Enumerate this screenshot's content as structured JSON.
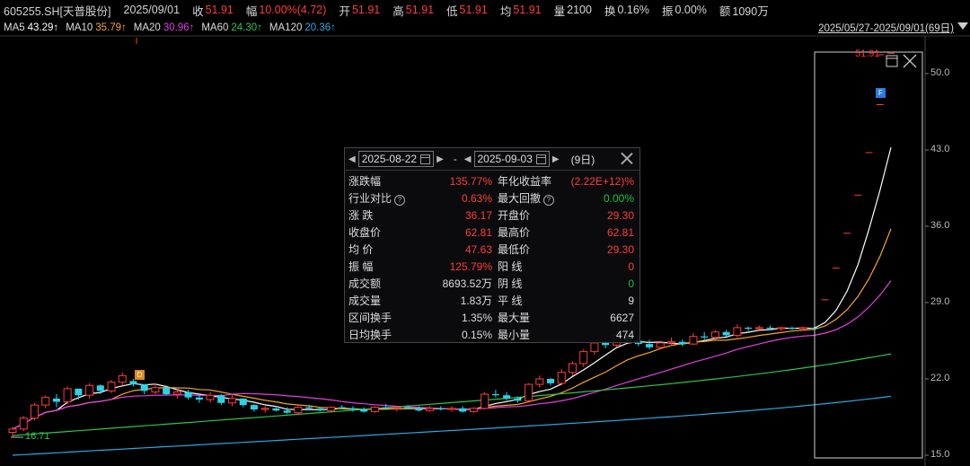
{
  "header": {
    "code": "605255.SH[天普股份]",
    "date": "2025/09/01",
    "close_label": "收",
    "close_value": "51.91",
    "change_label": "幅",
    "change_value": "10.00%(4.72)",
    "open_label": "开",
    "open_value": "51.91",
    "high_label": "高",
    "high_value": "51.91",
    "low_label": "低",
    "low_value": "51.91",
    "avg_label": "均",
    "avg_value": "51.91",
    "volume_label": "量",
    "volume_value": "2100",
    "turnover_label": "换",
    "turnover_value": "0.16%",
    "amplitude_label": "振",
    "amplitude_value": "0.00%",
    "amount_label": "额",
    "amount_value": "1090万"
  },
  "ma_bar": [
    {
      "name": "MA5",
      "value": "43.29↑",
      "color": "#ffffff"
    },
    {
      "name": "MA10",
      "value": "35.79↑",
      "color": "#f5a623"
    },
    {
      "name": "MA20",
      "value": "30.96↑",
      "color": "#e040e0"
    },
    {
      "name": "MA60",
      "value": "24.30↑",
      "color": "#2ec54a"
    },
    {
      "name": "MA120",
      "value": "20.36↑",
      "color": "#2aa8e0"
    }
  ],
  "date_range": "2025/05/27-2025/09/01(69日)",
  "popup": {
    "start_date": "2025-08-22",
    "end_date": "2025-09-03",
    "days": "(9日)",
    "rows": [
      {
        "l1": "涨跌幅",
        "v1": "135.77%",
        "c1": "r",
        "l2": "年化收益率",
        "v2": "(2.22E+12)%",
        "c2": "r"
      },
      {
        "l1": "行业对比",
        "q1": true,
        "v1": "0.63%",
        "c1": "r",
        "l2": "最大回撤",
        "q2": true,
        "v2": "0.00%",
        "c2": "g"
      },
      {
        "l1": "涨 跌",
        "v1": "36.17",
        "c1": "r",
        "l2": "开盘价",
        "v2": "29.30",
        "c2": "r"
      },
      {
        "l1": "收盘价",
        "v1": "62.81",
        "c1": "r",
        "l2": "最高价",
        "v2": "62.81",
        "c2": "r"
      },
      {
        "l1": "均 价",
        "v1": "47.63",
        "c1": "r",
        "l2": "最低价",
        "v2": "29.30",
        "c2": "r"
      },
      {
        "l1": "振 幅",
        "v1": "125.79%",
        "c1": "r",
        "l2": "阳 线",
        "v2": "0",
        "c2": "r"
      },
      {
        "l1": "成交额",
        "v1": "8693.52万",
        "c1": "w",
        "l2": "阴 线",
        "v2": "0",
        "c2": "g"
      },
      {
        "l1": "成交量",
        "v1": "1.83万",
        "c1": "w",
        "l2": "平 线",
        "v2": "9",
        "c2": "w"
      },
      {
        "l1": "区间换手",
        "v1": "1.35%",
        "c1": "w",
        "l2": "最大量",
        "v2": "6627",
        "c2": "w"
      },
      {
        "l1": "日均换手",
        "v1": "0.15%",
        "c1": "w",
        "l2": "最小量",
        "v2": "474",
        "c2": "w"
      }
    ]
  },
  "axis": {
    "labels": [
      "50.0",
      "43.0",
      "36.0",
      "29.0",
      "22.0",
      "15.0"
    ],
    "values": [
      50,
      43,
      36,
      29,
      22,
      15
    ]
  },
  "annotations": {
    "max_price": "51.91",
    "min_price": "16.71",
    "marker_d": "D",
    "marker_f": "F"
  },
  "chart_data": {
    "type": "candlestick",
    "ylim": [
      15,
      52
    ],
    "candles": [
      [
        17.1,
        17.6,
        16.7,
        17.4
      ],
      [
        17.4,
        18.6,
        17.2,
        18.4
      ],
      [
        18.4,
        19.8,
        18.2,
        19.6
      ],
      [
        19.6,
        20.5,
        19.3,
        20.3
      ],
      [
        20.2,
        20.6,
        19.4,
        19.9
      ],
      [
        19.9,
        21.3,
        19.7,
        21.1
      ],
      [
        21.1,
        21.0,
        20.1,
        20.5
      ],
      [
        20.5,
        21.6,
        20.2,
        21.4
      ],
      [
        21.4,
        21.5,
        20.6,
        20.9
      ],
      [
        20.9,
        21.9,
        20.7,
        21.7
      ],
      [
        21.7,
        22.6,
        21.4,
        22.3
      ],
      [
        21.8,
        22.0,
        21.3,
        21.5
      ],
      [
        21.5,
        21.5,
        20.6,
        20.9
      ],
      [
        20.8,
        21.6,
        20.6,
        21.2
      ],
      [
        21.2,
        21.4,
        20.5,
        20.6
      ],
      [
        20.6,
        21.0,
        20.2,
        20.8
      ],
      [
        20.8,
        21.0,
        20.1,
        20.3
      ],
      [
        20.3,
        20.7,
        19.8,
        20.1
      ],
      [
        20.1,
        20.8,
        19.8,
        20.5
      ],
      [
        20.5,
        20.6,
        19.6,
        19.8
      ],
      [
        19.8,
        20.5,
        19.5,
        20.2
      ],
      [
        20.2,
        20.2,
        19.4,
        19.6
      ],
      [
        19.6,
        19.7,
        19.0,
        19.2
      ],
      [
        19.2,
        19.5,
        18.9,
        19.3
      ],
      [
        19.3,
        19.5,
        19.0,
        19.1
      ],
      [
        19.1,
        19.4,
        18.8,
        18.9
      ],
      [
        18.9,
        19.5,
        18.8,
        19.4
      ],
      [
        19.4,
        19.6,
        19.1,
        19.3
      ],
      [
        19.3,
        19.4,
        19.0,
        19.1
      ],
      [
        19.1,
        19.5,
        18.9,
        19.4
      ],
      [
        19.4,
        19.6,
        19.2,
        19.3
      ],
      [
        19.3,
        19.5,
        19.0,
        19.2
      ],
      [
        19.2,
        19.4,
        18.9,
        19.0
      ],
      [
        19.0,
        19.5,
        18.9,
        19.4
      ],
      [
        19.4,
        19.7,
        19.2,
        19.3
      ],
      [
        19.3,
        19.5,
        19.0,
        19.4
      ],
      [
        19.4,
        19.6,
        19.2,
        19.3
      ],
      [
        19.3,
        19.5,
        19.0,
        19.1
      ],
      [
        19.1,
        19.5,
        19.0,
        19.3
      ],
      [
        19.3,
        19.5,
        19.1,
        19.2
      ],
      [
        19.2,
        19.5,
        19.0,
        19.3
      ],
      [
        19.3,
        19.5,
        18.9,
        19.0
      ],
      [
        19.0,
        19.4,
        18.9,
        19.3
      ],
      [
        19.3,
        20.8,
        19.2,
        20.6
      ],
      [
        20.6,
        21.0,
        20.3,
        20.5
      ],
      [
        20.5,
        20.8,
        20.0,
        20.2
      ],
      [
        20.2,
        20.4,
        19.8,
        20.0
      ],
      [
        20.0,
        21.6,
        19.9,
        21.5
      ],
      [
        21.5,
        22.3,
        21.2,
        22.0
      ],
      [
        22.0,
        22.1,
        21.4,
        21.6
      ],
      [
        21.6,
        22.9,
        21.4,
        22.6
      ],
      [
        22.6,
        23.6,
        22.3,
        23.4
      ],
      [
        23.4,
        24.7,
        23.1,
        24.5
      ],
      [
        24.5,
        25.5,
        24.2,
        25.3
      ],
      [
        25.3,
        26.0,
        24.8,
        25.1
      ],
      [
        25.1,
        26.3,
        24.9,
        26.0
      ],
      [
        26.0,
        26.2,
        25.3,
        25.5
      ],
      [
        25.5,
        25.7,
        25.0,
        25.2
      ],
      [
        25.2,
        25.6,
        24.7,
        24.9
      ],
      [
        24.9,
        25.5,
        24.7,
        25.3
      ],
      [
        25.3,
        25.8,
        25.0,
        25.4
      ],
      [
        25.4,
        25.6,
        25.0,
        25.2
      ],
      [
        25.2,
        26.2,
        25.1,
        25.9
      ],
      [
        25.9,
        26.3,
        25.5,
        25.8
      ],
      [
        25.8,
        26.5,
        25.6,
        26.3
      ],
      [
        26.3,
        26.5,
        25.9,
        26.0
      ],
      [
        26.0,
        27.0,
        25.8,
        26.7
      ],
      [
        26.7,
        26.8,
        26.4,
        26.6
      ],
      [
        26.6,
        26.9,
        26.5,
        26.7
      ],
      [
        26.7,
        26.9,
        26.5,
        26.6
      ],
      [
        26.6,
        26.8,
        26.4,
        26.7
      ],
      [
        26.7,
        26.8,
        26.5,
        26.6
      ],
      [
        26.6,
        26.8,
        26.5,
        26.7
      ],
      [
        26.7,
        26.8,
        26.5,
        26.6
      ],
      [
        29.3,
        29.3,
        29.3,
        29.3
      ],
      [
        32.2,
        32.2,
        32.2,
        32.2
      ],
      [
        35.4,
        35.4,
        35.4,
        35.4
      ],
      [
        38.9,
        38.9,
        38.9,
        38.9
      ],
      [
        42.8,
        42.8,
        42.8,
        42.8
      ],
      [
        47.2,
        47.2,
        47.2,
        47.2
      ],
      [
        51.91,
        51.91,
        51.91,
        51.91
      ]
    ]
  }
}
